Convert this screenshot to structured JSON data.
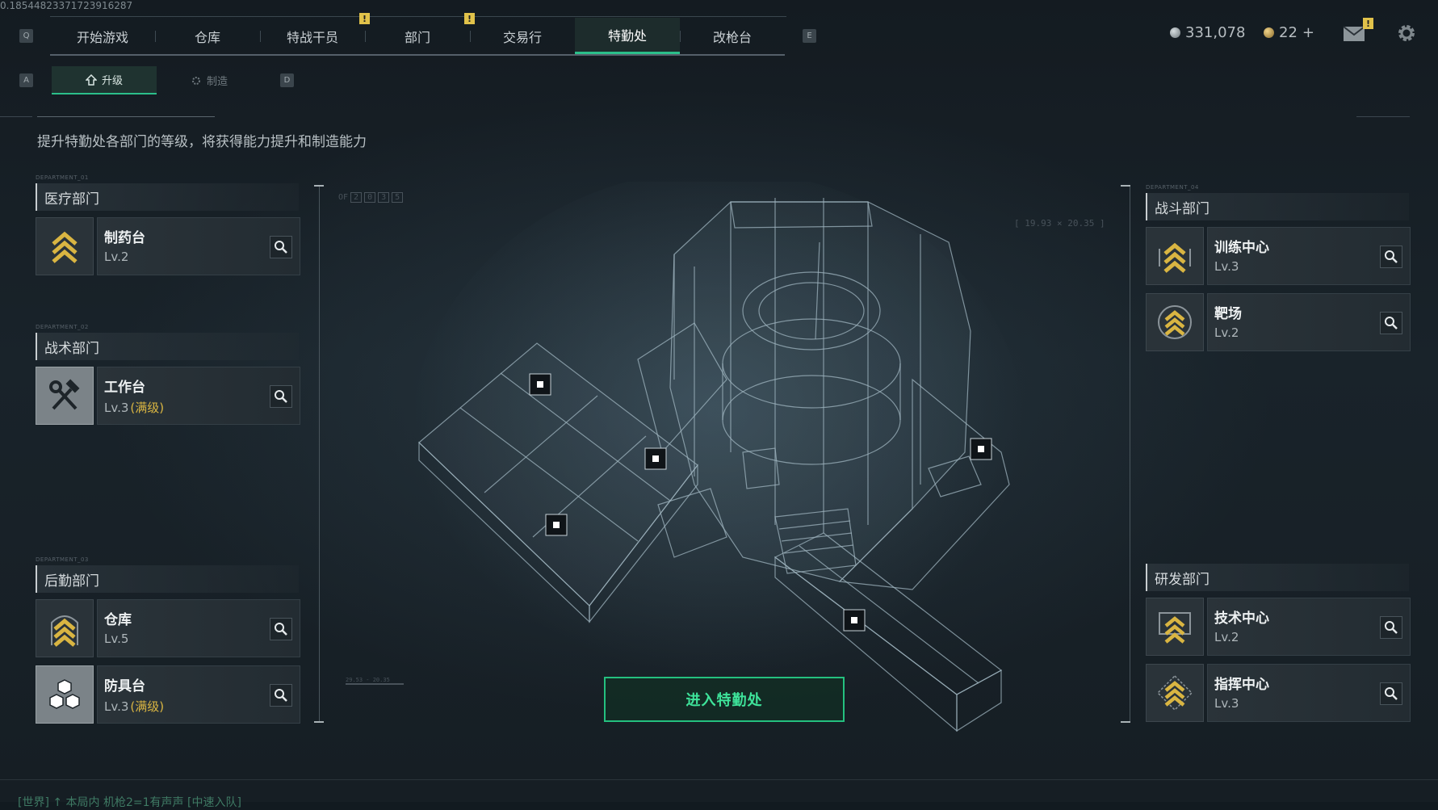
{
  "debug_id": "0.18544823371723916287",
  "nav": {
    "key_left": "Q",
    "key_right": "E",
    "tabs": [
      {
        "label": "开始游戏"
      },
      {
        "label": "仓库"
      },
      {
        "label": "特战干员",
        "alert": "!"
      },
      {
        "label": "部门",
        "alert": "!"
      },
      {
        "label": "交易行"
      },
      {
        "label": "特勤处",
        "active": true
      },
      {
        "label": "改枪台"
      }
    ]
  },
  "currency": {
    "silver": "331,078",
    "gold": "22",
    "gold_add": "+",
    "silver_color": "#9aa4aa",
    "gold_color": "#c8a24a"
  },
  "header_icons": [
    "mail-icon",
    "gear-icon"
  ],
  "mail_alert": "!",
  "subtabs": {
    "key_left": "A",
    "key_right": "D",
    "upgrade": "升级",
    "craft": "制造"
  },
  "description": "提升特勤处各部门的等级，将获得能力提升和制造能力",
  "departments": {
    "medical": {
      "tiny": "DEPARTMENT_01",
      "title": "医疗部门",
      "items": [
        {
          "name": "制药台",
          "level": "Lv.2",
          "icon": "chevron-rank-icon"
        }
      ]
    },
    "tactical": {
      "tiny": "DEPARTMENT_02",
      "title": "战术部门",
      "items": [
        {
          "name": "工作台",
          "level": "Lv.3",
          "max": "(满级)",
          "icon": "hammer-wrench-icon"
        }
      ]
    },
    "logistics": {
      "tiny": "DEPARTMENT_03",
      "title": "后勤部门",
      "items": [
        {
          "name": "仓库",
          "level": "Lv.5",
          "icon": "chevron-rank-icon"
        },
        {
          "name": "防具台",
          "level": "Lv.3",
          "max": "(满级)",
          "icon": "cubes-icon"
        }
      ]
    },
    "combat": {
      "tiny": "DEPARTMENT_04",
      "title": "战斗部门",
      "items": [
        {
          "name": "训练中心",
          "level": "Lv.3",
          "icon": "chevron-rank-icon"
        },
        {
          "name": "靶场",
          "level": "Lv.2",
          "icon": "chevron-rank-icon"
        }
      ]
    },
    "research": {
      "title": "研发部门",
      "items": [
        {
          "name": "技术中心",
          "level": "Lv.2",
          "icon": "chevron-rank-icon"
        },
        {
          "name": "指挥中心",
          "level": "Lv.3",
          "icon": "chevron-rank-icon"
        }
      ]
    }
  },
  "hud": {
    "of_label": "OF",
    "of_boxes": [
      "2",
      "0",
      "3",
      "5"
    ],
    "coords": "[ 19.93 × 20.35 ]",
    "stamp": "29.53 - 20.35"
  },
  "enter_button": "进入特勤处",
  "bottom_text": "[世界] ↑ 本局内 机枪2=1有声声 [中速入队]"
}
